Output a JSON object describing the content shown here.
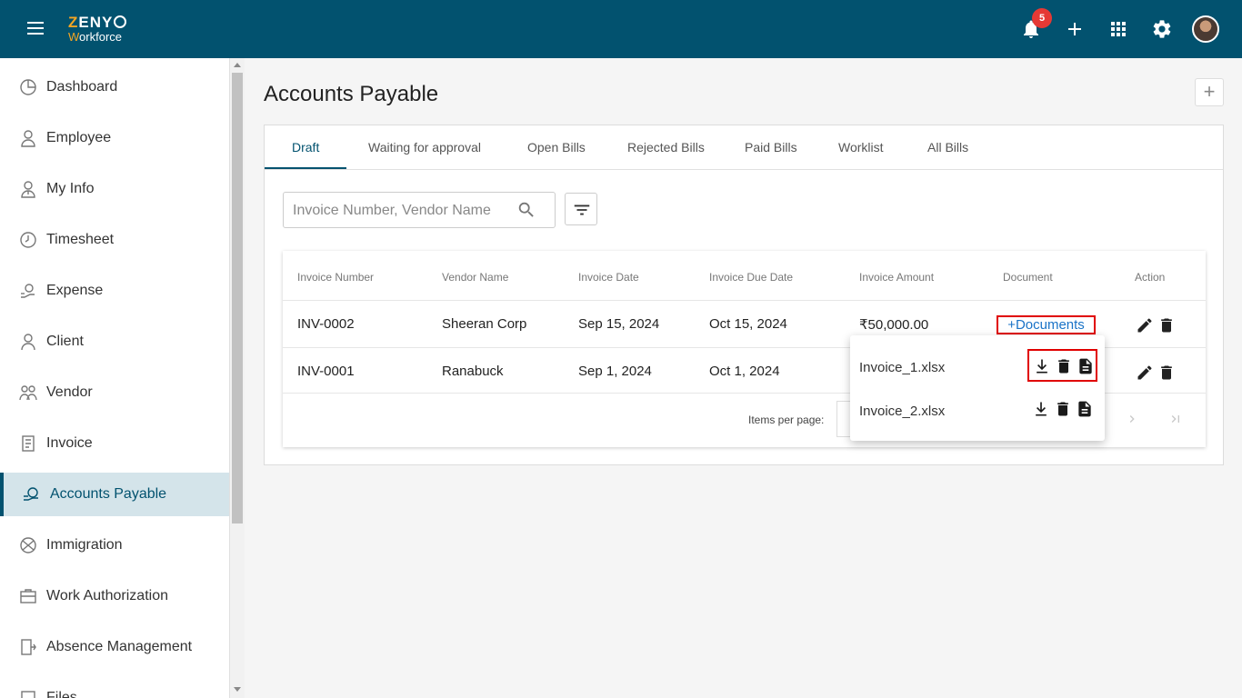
{
  "app": {
    "logo_line1_accent": "Z",
    "logo_line1_rest": "ENY",
    "logo_line2_accent": "W",
    "logo_line2_rest": "orkforce"
  },
  "header": {
    "notification_count": "5"
  },
  "sidebar": {
    "items": [
      {
        "label": "Dashboard",
        "icon": "dashboard-icon"
      },
      {
        "label": "Employee",
        "icon": "employee-icon"
      },
      {
        "label": "My Info",
        "icon": "my-info-icon"
      },
      {
        "label": "Timesheet",
        "icon": "clock-icon"
      },
      {
        "label": "Expense",
        "icon": "expense-icon"
      },
      {
        "label": "Client",
        "icon": "client-icon"
      },
      {
        "label": "Vendor",
        "icon": "vendor-icon"
      },
      {
        "label": "Invoice",
        "icon": "invoice-icon"
      },
      {
        "label": "Accounts Payable",
        "icon": "accounts-payable-icon",
        "active": true
      },
      {
        "label": "Immigration",
        "icon": "globe-icon"
      },
      {
        "label": "Work Authorization",
        "icon": "work-authorization-icon"
      },
      {
        "label": "Absence Management",
        "icon": "absence-icon"
      },
      {
        "label": "Files",
        "icon": "files-icon"
      }
    ]
  },
  "main": {
    "title": "Accounts Payable",
    "tabs": [
      "Draft",
      "Waiting for approval",
      "Open Bills",
      "Rejected Bills",
      "Paid Bills",
      "Worklist",
      "All Bills"
    ],
    "active_tab": "Draft",
    "search": {
      "placeholder": "Invoice Number, Vendor Name"
    },
    "table": {
      "headers": [
        "Invoice Number",
        "Vendor Name",
        "Invoice Date",
        "Invoice Due Date",
        "Invoice Amount",
        "Document",
        "Action"
      ],
      "rows": [
        {
          "number": "INV-0002",
          "vendor": "Sheeran Corp",
          "date": "Sep 15, 2024",
          "due": "Oct 15, 2024",
          "amount": "₹50,000.00",
          "document": "+Documents"
        },
        {
          "number": "INV-0001",
          "vendor": "Ranabuck",
          "date": "Sep 1, 2024",
          "due": "Oct 1, 2024"
        }
      ]
    },
    "paginator": {
      "items_per_page_label": "Items per page:"
    }
  },
  "documents_popup": {
    "files": [
      "Invoice_1.xlsx",
      "Invoice_2.xlsx"
    ]
  },
  "colors": {
    "header_bg": "#02526f",
    "accent": "#02526f",
    "link": "#1a73c7",
    "highlight": "#e00000",
    "badge": "#e53935"
  }
}
